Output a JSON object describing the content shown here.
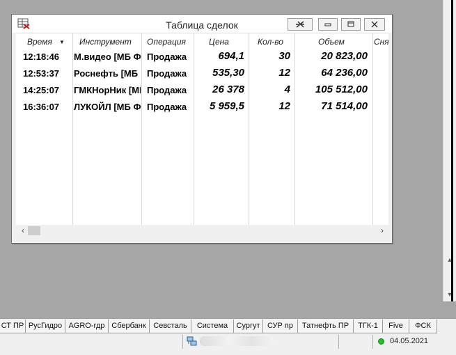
{
  "window": {
    "title": "Таблица сделок",
    "columns": [
      "Время",
      "Инструмент",
      "Операция",
      "Цена",
      "Кол-во",
      "Объем",
      "Снята"
    ],
    "rows": [
      {
        "time": "12:18:46",
        "instrument": "М.видео [МБ Ф",
        "operation": "Продажа",
        "price": "694,1",
        "qty": "30",
        "volume": "20 823,00"
      },
      {
        "time": "12:53:37",
        "instrument": "Роснефть [МБ",
        "operation": "Продажа",
        "price": "535,30",
        "qty": "12",
        "volume": "64 236,00"
      },
      {
        "time": "14:25:07",
        "instrument": "ГМКНорНик [МI",
        "operation": "Продажа",
        "price": "26 378",
        "qty": "4",
        "volume": "105 512,00"
      },
      {
        "time": "16:36:07",
        "instrument": "ЛУКОЙЛ [МБ Ф",
        "operation": "Продажа",
        "price": "5 959,5",
        "qty": "12",
        "volume": "71 514,00"
      }
    ]
  },
  "tabs": [
    "СТ ПР",
    "РусГидро",
    "AGRO-гдр",
    "Сбербанк",
    "Севсталь",
    "Система",
    "Сургут",
    "СУР пр",
    "Татнефть ПР",
    "ТГК-1",
    "Five",
    "ФСК"
  ],
  "status": {
    "connection_color": "#21c521",
    "date": "04.05.2021"
  }
}
